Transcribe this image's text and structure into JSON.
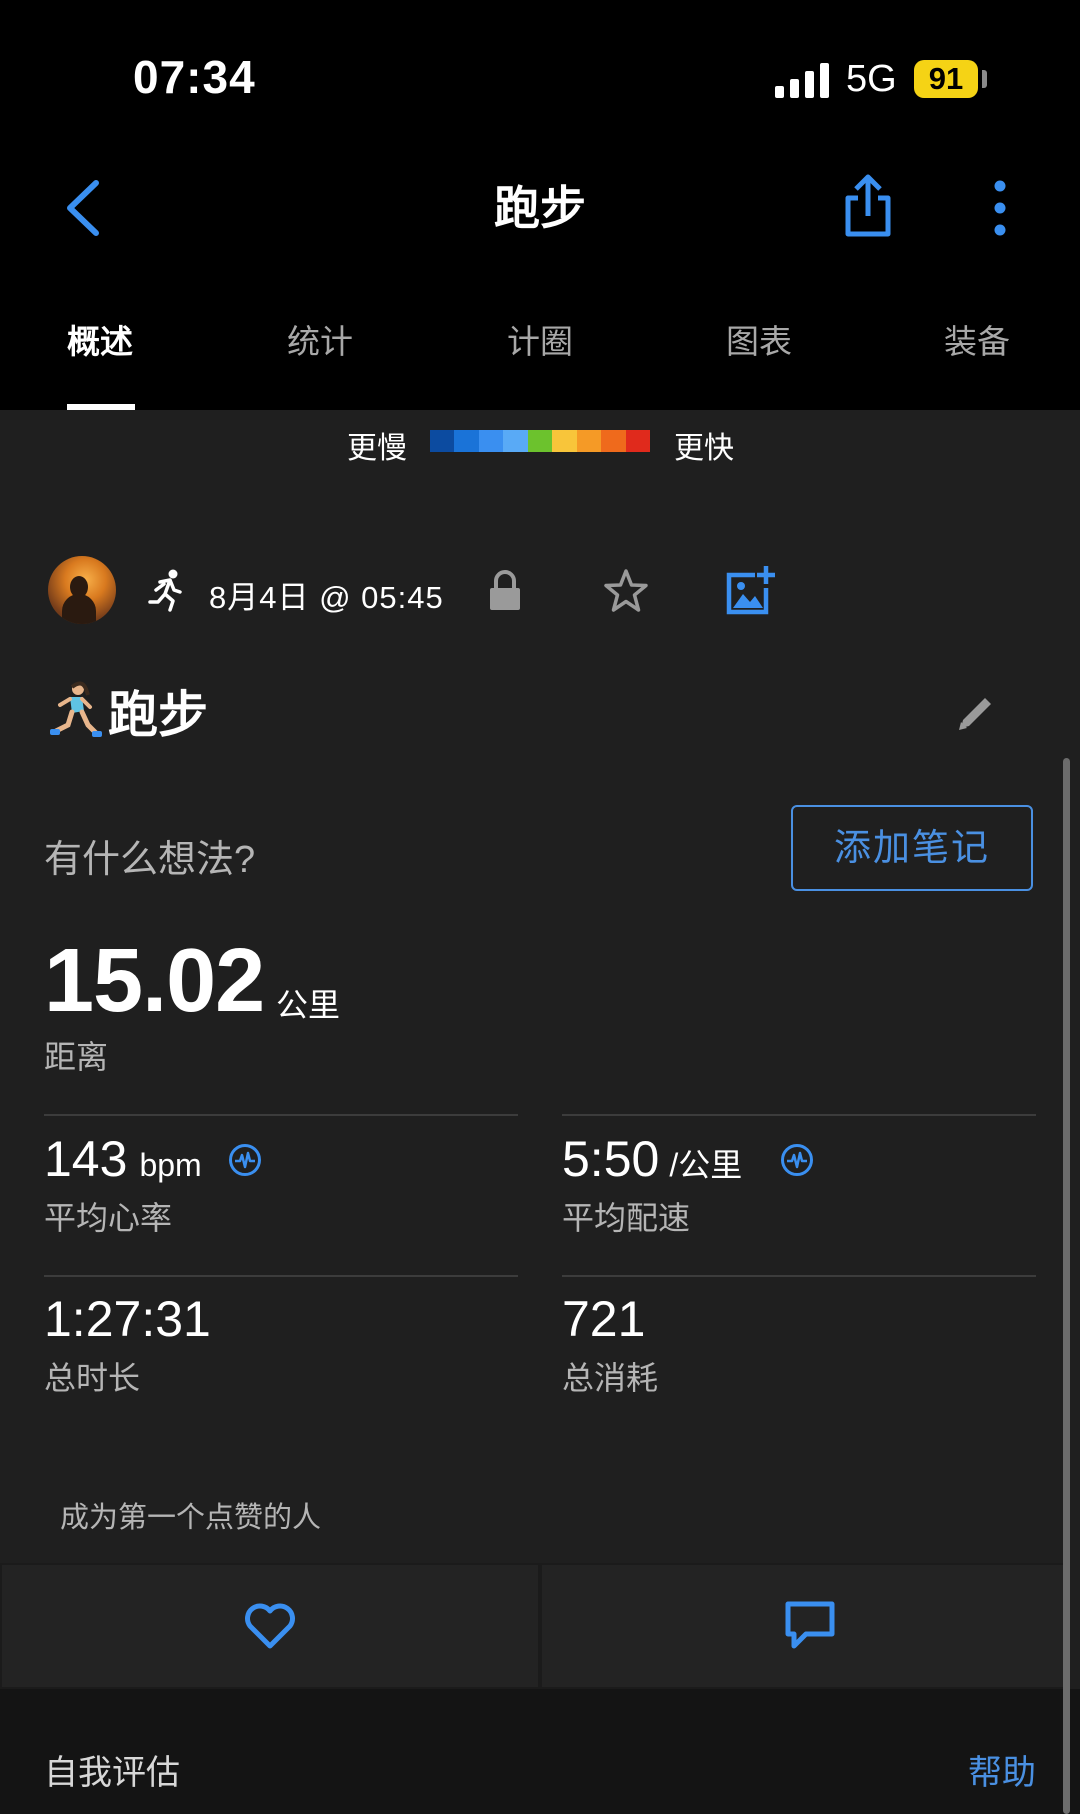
{
  "status_bar": {
    "time": "07:34",
    "network": "5G",
    "battery": "91"
  },
  "header": {
    "title": "跑步"
  },
  "tabs": [
    {
      "label": "概述",
      "active": true
    },
    {
      "label": "统计"
    },
    {
      "label": "计圈"
    },
    {
      "label": "图表"
    },
    {
      "label": "装备"
    }
  ],
  "legend": {
    "slow": "更慢",
    "fast": "更快",
    "colors": [
      "#0c4ba0",
      "#1a73d8",
      "#3a8ff0",
      "#59aaf6",
      "#6cc22d",
      "#f8c53a",
      "#f59a26",
      "#ef6a1c",
      "#e02a1c"
    ]
  },
  "activity": {
    "date": "8月4日 @ 05:45",
    "title": "跑步",
    "prompt": "有什么想法?",
    "add_note": "添加笔记"
  },
  "stats": {
    "distance": {
      "value": "15.02",
      "unit": "公里",
      "label": "距离"
    },
    "avg_hr": {
      "value": "143",
      "unit": "bpm",
      "label": "平均心率"
    },
    "avg_pace": {
      "value": "5:50",
      "unit": "/公里",
      "label": "平均配速"
    },
    "duration": {
      "value": "1:27:31",
      "label": "总时长"
    },
    "calories": {
      "value": "721",
      "label": "总消耗"
    }
  },
  "social": {
    "likes_text": "成为第一个点赞的人"
  },
  "footer": {
    "self_eval": "自我评估",
    "help": "帮助"
  },
  "colors": {
    "accent": "#4a90e2",
    "battery": "#f5d315"
  }
}
